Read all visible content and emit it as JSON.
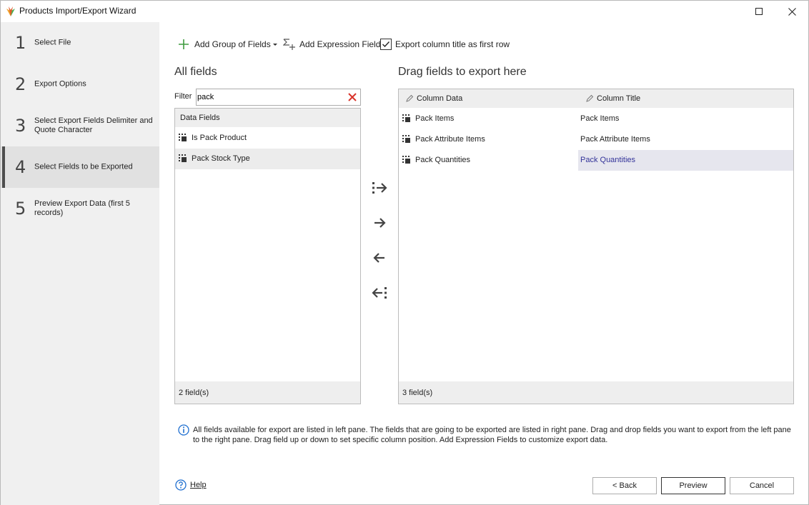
{
  "window": {
    "title": "Products Import/Export Wizard"
  },
  "sidebar": {
    "steps": [
      {
        "number": "1",
        "label": "Select File"
      },
      {
        "number": "2",
        "label": "Export Options"
      },
      {
        "number": "3",
        "label": "Select Export Fields Delimiter and Quote Character"
      },
      {
        "number": "4",
        "label": "Select Fields to be Exported"
      },
      {
        "number": "5",
        "label": "Preview Export Data (first 5 records)"
      }
    ],
    "active_step": 4
  },
  "toolbar": {
    "add_group_label": "Add Group of Fields",
    "add_expression_label": "Add Expression Field",
    "export_title_label": "Export column title as first row",
    "export_title_checked": true
  },
  "left_pane": {
    "heading": "All fields",
    "filter_label": "Filter",
    "filter_value": "pack",
    "group_header": "Data Fields",
    "items": [
      "Is Pack Product",
      "Pack Stock Type"
    ],
    "footer": "2 field(s)"
  },
  "right_pane": {
    "heading": "Drag fields to export here",
    "col_data_header": "Column Data",
    "col_title_header": "Column Title",
    "rows": [
      {
        "data": "Pack Items",
        "title": "Pack Items"
      },
      {
        "data": "Pack Attribute Items",
        "title": "Pack Attribute Items"
      },
      {
        "data": "Pack Quantities",
        "title": "Pack Quantities"
      }
    ],
    "footer": "3 field(s)"
  },
  "info_text": "All fields available for export are listed in left pane. The fields that are going to be exported are listed in right pane. Drag and drop fields you want to export from the left pane to the right pane. Drag field up or down to set specific column position. Add Expression Fields to customize export data.",
  "footer": {
    "help_label": "Help",
    "back_label": "< Back",
    "preview_label": "Preview",
    "cancel_label": "Cancel"
  },
  "colors": {
    "accent_green": "#3f9b3f",
    "clear_red": "#d9342b",
    "info_blue": "#1f6fd0",
    "selected_text": "#333399"
  },
  "icons": {
    "add_group": "plus-icon",
    "add_expression": "sigma-plus-icon",
    "move_all_right": "move-all-right-icon",
    "move_right": "arrow-right-icon",
    "move_left": "arrow-left-icon",
    "move_all_left": "move-all-left-icon"
  }
}
